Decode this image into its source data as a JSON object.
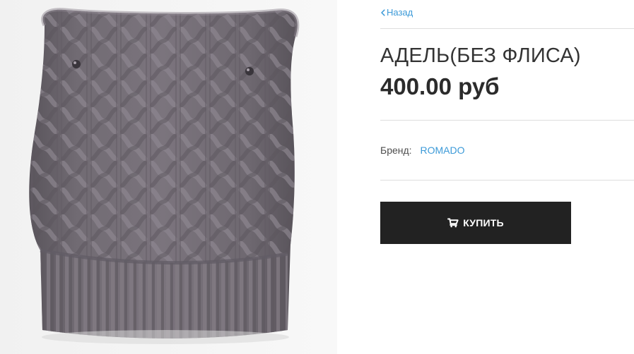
{
  "product": {
    "image_icon": "knitted-hat-image",
    "title": "АДЕЛЬ(БЕЗ ФЛИСА)",
    "price": "400.00 руб"
  },
  "navigation": {
    "back_label": "Назад",
    "back_icon": "chevron-left-icon"
  },
  "brand": {
    "label": "Бренд:",
    "value": "ROMADO"
  },
  "actions": {
    "buy_label": "КУПИТЬ",
    "buy_icon": "cart-icon"
  },
  "colors": {
    "link": "#3c9ad8",
    "button": "#222222",
    "divider": "#dedede",
    "hat": "#6f6971"
  }
}
